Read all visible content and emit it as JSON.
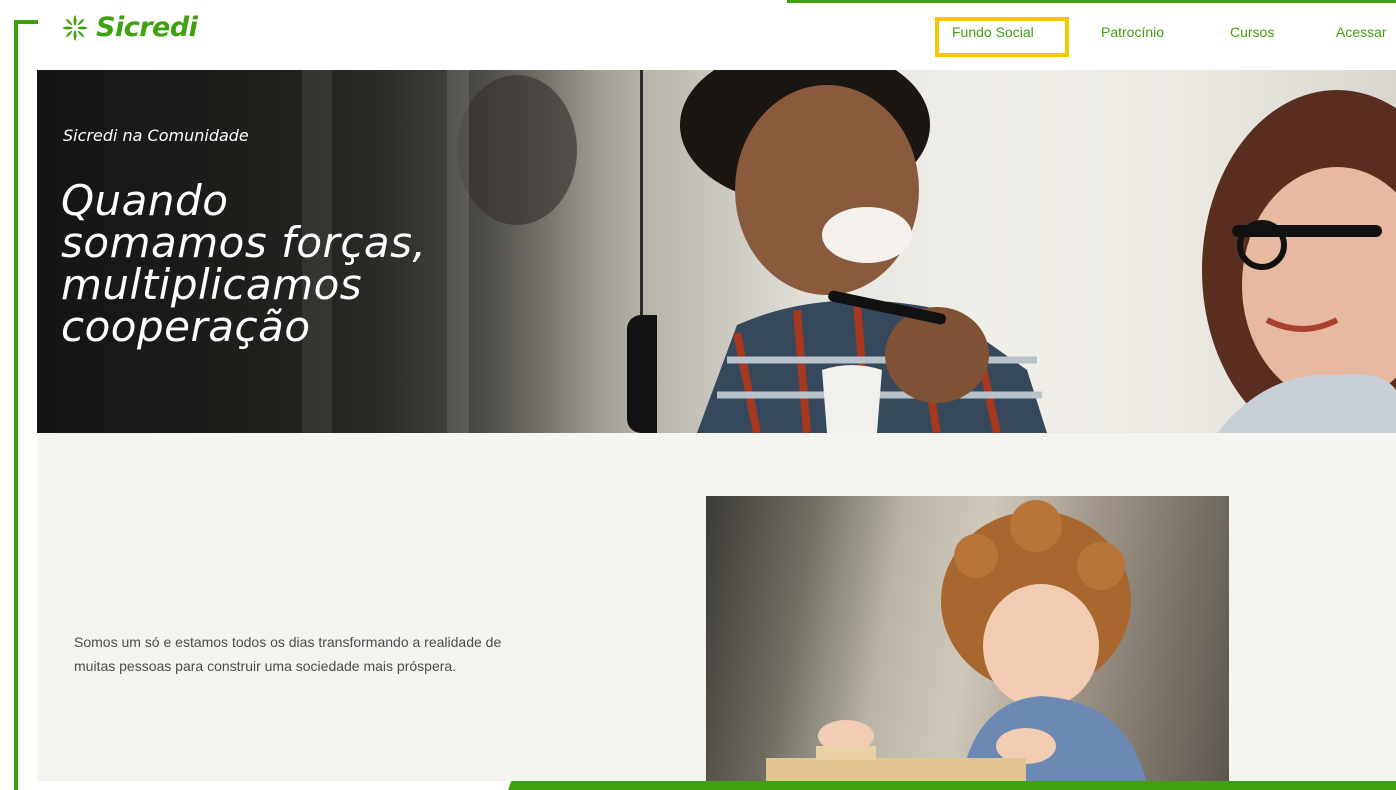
{
  "brand": {
    "name": "Sicredi",
    "color": "#3fa110"
  },
  "nav": {
    "items": [
      "Fundo Social",
      "Patrocínio",
      "Cursos",
      "Acessar"
    ],
    "highlighted": "Fundo Social",
    "highlight_color": "#f7c600"
  },
  "hero": {
    "eyebrow": "Sicredi na Comunidade",
    "title_lines": [
      "Quando",
      "somamos forças,",
      "multiplicamos",
      "cooperação"
    ]
  },
  "section": {
    "body": "Somos um só e estamos todos os dias transformando a realidade de muitas pessoas para construir uma sociedade mais próspera."
  },
  "icons": [
    "sicredi-logo-icon"
  ]
}
